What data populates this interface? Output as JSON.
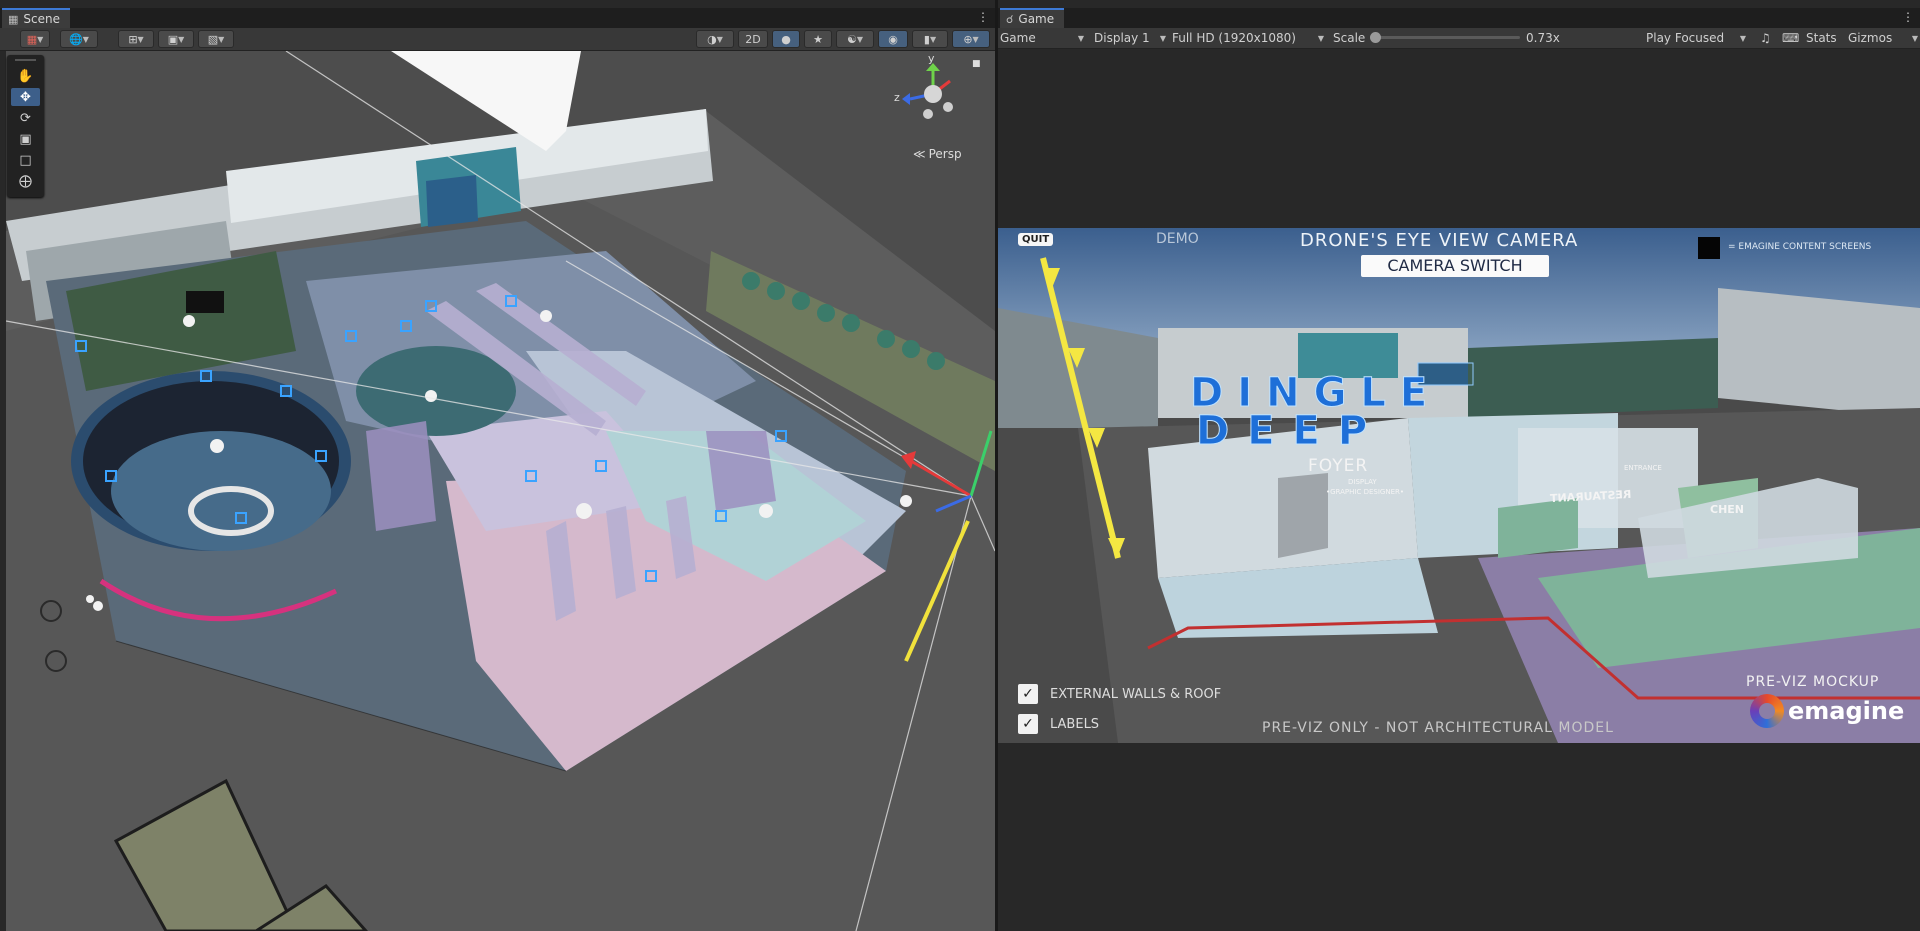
{
  "scene": {
    "tab_label": "Scene",
    "toolbar": {
      "btn_2d": "2D"
    },
    "persp_label": "Persp",
    "gizmo_axes": {
      "x": "x",
      "y": "y",
      "z": "z"
    }
  },
  "game": {
    "tab_label": "Game",
    "toolbar": {
      "mode": "Game",
      "display": "Display 1",
      "resolution": "Full HD (1920x1080)",
      "scale_label": "Scale",
      "scale_value": "0.73x",
      "play_mode": "Play Focused",
      "stats": "Stats",
      "gizmos": "Gizmos"
    },
    "overlay": {
      "quit": "QUIT",
      "demo": "DEMO",
      "camera_title": "DRONE'S EYE VIEW CAMERA",
      "camera_switch": "CAMERA SWITCH",
      "legend": "= EMAGINE CONTENT SCREENS",
      "toggles": [
        {
          "label": "EXTERNAL WALLS & ROOF",
          "checked": true
        },
        {
          "label": "LABELS",
          "checked": true
        }
      ],
      "footer_note": "PRE-VIZ ONLY - NOT ARCHITECTURAL MODEL",
      "mockup": "PRE-VIZ MOCKUP",
      "brand": "emagine"
    },
    "world_labels": {
      "sign_line1": "DINGLE",
      "sign_line2": "DEEP",
      "foyer": "FOYER",
      "display": "DISPLAY",
      "graphic": "•GRAPHIC DESIGNER•",
      "restaurant": "RESTAURANT",
      "kitchen": "CHEN",
      "entrance": "ENTRANCE"
    },
    "scale_fraction": 0.0
  }
}
